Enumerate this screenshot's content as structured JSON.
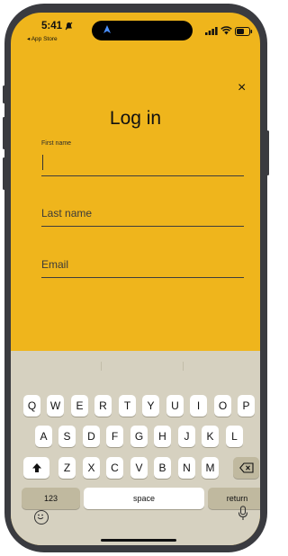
{
  "status_bar": {
    "time": "5:41",
    "back_label": "◂ App Store"
  },
  "login": {
    "title": "Log in",
    "close_label": "×",
    "first_name_label": "First name",
    "last_name_placeholder": "Last name",
    "email_placeholder": "Email"
  },
  "keyboard": {
    "row1": [
      "Q",
      "W",
      "E",
      "R",
      "T",
      "Y",
      "U",
      "I",
      "O",
      "P"
    ],
    "row2": [
      "A",
      "S",
      "D",
      "F",
      "G",
      "H",
      "J",
      "K",
      "L"
    ],
    "row3": [
      "Z",
      "X",
      "C",
      "V",
      "B",
      "N",
      "M"
    ],
    "shift_label": "⬆",
    "delete_label": "⌫",
    "numbers_label": "123",
    "space_label": "space",
    "return_label": "return"
  },
  "colors": {
    "accent": "#efb51c",
    "keyboard_bg": "#d6d1c0"
  }
}
